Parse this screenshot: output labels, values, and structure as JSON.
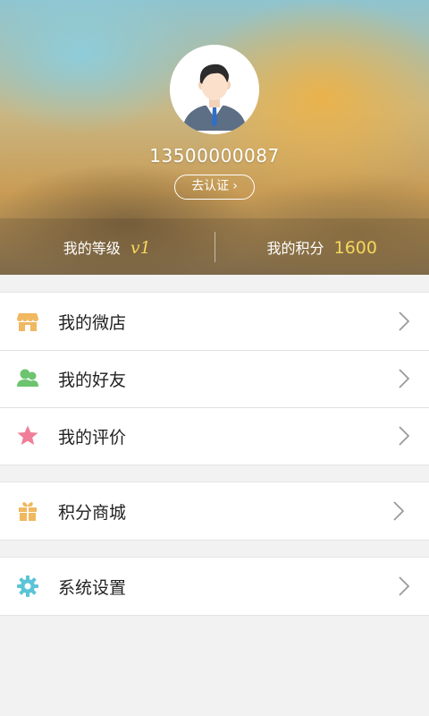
{
  "profile": {
    "phone": "13500000087",
    "verify_label": "去认证",
    "verify_chevron": "›"
  },
  "stats": {
    "level_label": "我的等级",
    "level_value": "v1",
    "points_label": "我的积分",
    "points_value": "1600"
  },
  "menu": {
    "shop": "我的微店",
    "friends": "我的好友",
    "reviews": "我的评价",
    "mall": "积分商城",
    "settings": "系统设置"
  },
  "colors": {
    "shop_icon": "#f0b860",
    "friends_icon": "#6cc46f",
    "reviews_icon": "#f07e98",
    "mall_icon": "#f0b860",
    "settings_icon": "#5bc4d6",
    "value_accent": "#f5d75c"
  },
  "icons": {
    "shop": "store-icon",
    "friends": "users-icon",
    "reviews": "star-icon",
    "mall": "gift-icon",
    "settings": "gear-icon",
    "arrow": "chevron-right-icon"
  }
}
